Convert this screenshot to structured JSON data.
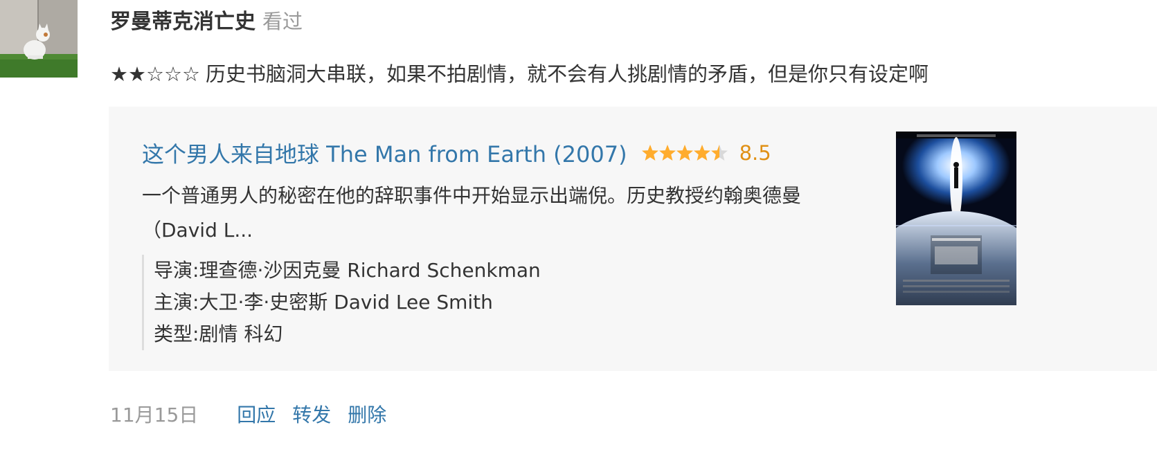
{
  "user": {
    "name": "罗曼蒂克消亡史",
    "action": "看过"
  },
  "review": {
    "stars": "★★☆☆☆",
    "rating_value": 2,
    "rating_max": 5,
    "text": "历史书脑洞大串联，如果不拍剧情，就不会有人挑剧情的矛盾，但是你只有设定啊"
  },
  "movie": {
    "title": "这个男人来自地球 The Man from Earth (2007)",
    "score": "8.5",
    "star_rating": 4.5,
    "synopsis": "一个普通男人的秘密在他的辞职事件中开始显示出端倪。历史教授约翰奥德曼（David L...",
    "director_label": "导演:",
    "director": "理查德·沙因克曼 Richard Schenkman",
    "cast_label": "主演:",
    "cast": "大卫·李·史密斯 David Lee Smith",
    "genre_label": "类型:",
    "genre": "剧情 科幻"
  },
  "footer": {
    "date": "11月15日",
    "reply": "回应",
    "share": "转发",
    "delete": "删除"
  },
  "colors": {
    "link": "#3377aa",
    "score": "#e09015",
    "muted": "#999999",
    "card_bg": "#f7f7f7",
    "star_fill": "#ffac2d"
  }
}
